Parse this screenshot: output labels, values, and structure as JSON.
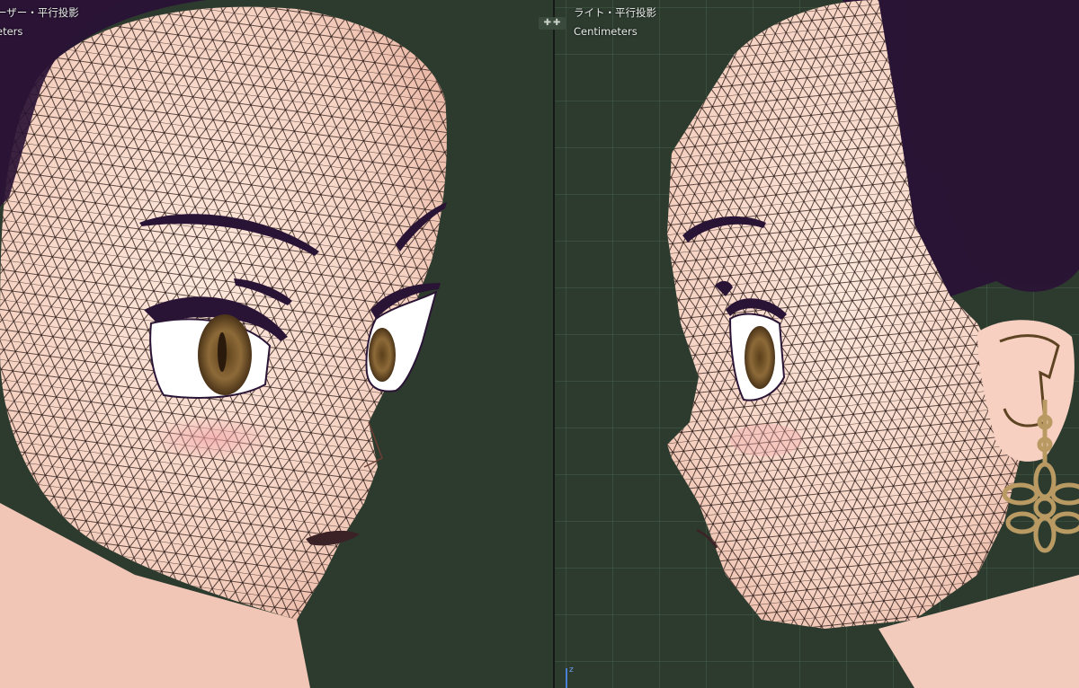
{
  "left_viewport": {
    "view_title": "ーザー・平行投影",
    "units": "eters"
  },
  "right_viewport": {
    "view_title": "ライト・平行投影",
    "units": "Centimeters"
  },
  "icons": {
    "area_join_widget": "plus-icon",
    "axis_gizmo": "z-axis-icon"
  },
  "colors": {
    "viewport_background": "#2d3b2f",
    "grid_line": "#465c48",
    "skin": "#f6d6c8",
    "hair": "#2a1435",
    "wireframe": "#2b1a16",
    "iris": "#8a6a3a",
    "earring": "#b89a62"
  }
}
